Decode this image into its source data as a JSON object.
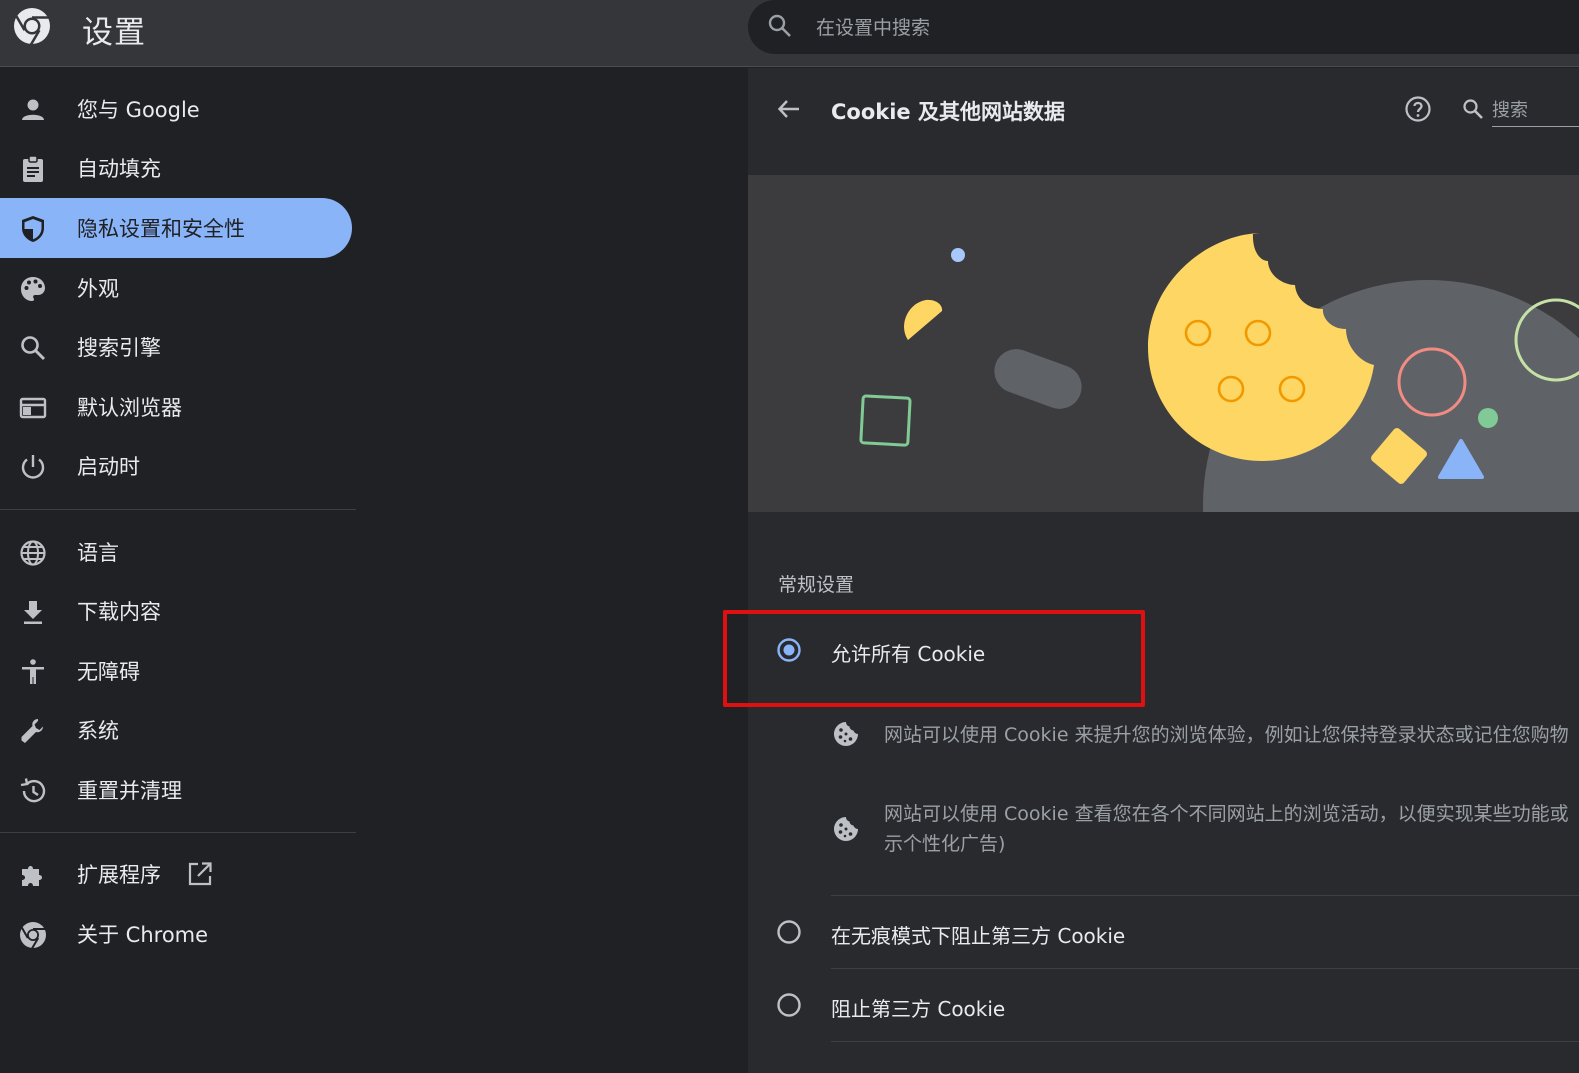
{
  "topbar": {
    "title": "设置",
    "search_placeholder": "在设置中搜索"
  },
  "sidebar": {
    "items": [
      {
        "label": "您与 Google",
        "icon": "person-icon"
      },
      {
        "label": "自动填充",
        "icon": "clipboard-icon"
      },
      {
        "label": "隐私设置和安全性",
        "icon": "shield-icon",
        "active": true
      },
      {
        "label": "外观",
        "icon": "palette-icon"
      },
      {
        "label": "搜索引擎",
        "icon": "search-icon"
      },
      {
        "label": "默认浏览器",
        "icon": "browser-window-icon"
      },
      {
        "label": "启动时",
        "icon": "power-icon"
      }
    ],
    "advanced": [
      {
        "label": "语言",
        "icon": "globe-icon"
      },
      {
        "label": "下载内容",
        "icon": "download-icon"
      },
      {
        "label": "无障碍",
        "icon": "accessibility-icon"
      },
      {
        "label": "系统",
        "icon": "wrench-icon"
      },
      {
        "label": "重置并清理",
        "icon": "history-icon"
      }
    ],
    "footer": [
      {
        "label": "扩展程序",
        "icon": "puzzle-icon"
      },
      {
        "label": "关于 Chrome",
        "icon": "chrome-icon"
      }
    ]
  },
  "panel": {
    "title": "Cookie 及其他网站数据",
    "search_label": "搜索",
    "section_title": "常规设置",
    "options": [
      {
        "label": "允许所有 Cookie",
        "selected": true
      },
      {
        "label": "在无痕模式下阻止第三方 Cookie",
        "selected": false
      },
      {
        "label": "阻止第三方 Cookie",
        "selected": false
      }
    ],
    "descriptions": [
      {
        "line1": "网站可以使用 Cookie 来提升您的浏览体验，例如让您保持登录状态或记住您购物"
      },
      {
        "line1": "网站可以使用 Cookie 查看您在各个不同网站上的浏览活动，以便实现某些功能或",
        "line2": "示个性化广告)"
      }
    ]
  },
  "colors": {
    "accent": "#8ab4f8",
    "highlight": "#e01010",
    "cookie": "#fdd663"
  }
}
